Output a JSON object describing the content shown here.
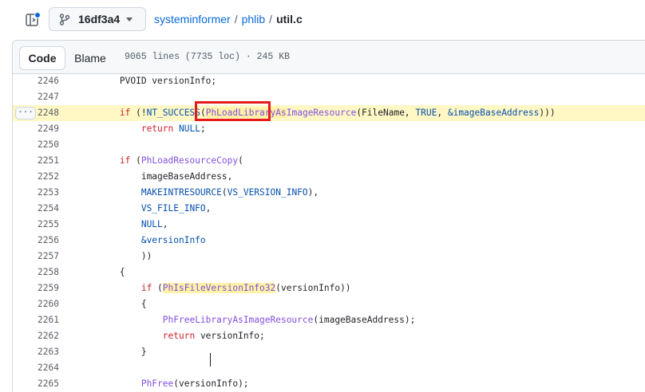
{
  "header": {
    "branch": "16df3a4",
    "breadcrumb": {
      "repo": "systeminformer",
      "folder": "phlib",
      "file": "util.c"
    }
  },
  "file_toolbar": {
    "tabs": [
      {
        "label": "Code",
        "selected": true
      },
      {
        "label": "Blame",
        "selected": false
      }
    ],
    "meta": "9065 lines (7735 loc) · 245 KB"
  },
  "code": {
    "highlighted_line": "2248",
    "lines": [
      {
        "num": "2246",
        "indent": "        ",
        "segments": [
          {
            "t": "PVOID versionInfo;"
          }
        ]
      },
      {
        "num": "2247",
        "indent": "",
        "segments": []
      },
      {
        "num": "2248",
        "indent": "        ",
        "segments": [
          {
            "t": "if",
            "c": "kw"
          },
          {
            "t": " (!"
          },
          {
            "t": "NT_SUCCESS",
            "c": "mc"
          },
          {
            "t": "("
          },
          {
            "t": "PhLoadLibraryAs",
            "c": "fn sym"
          },
          {
            "t": "ImageResource",
            "c": "fn"
          },
          {
            "t": "(FileName, "
          },
          {
            "t": "TRUE",
            "c": "mc"
          },
          {
            "t": ", "
          },
          {
            "t": "&imageBaseAddress",
            "c": "mc"
          },
          {
            "t": ")))"
          }
        ]
      },
      {
        "num": "2249",
        "indent": "            ",
        "segments": [
          {
            "t": "return",
            "c": "kw"
          },
          {
            "t": " "
          },
          {
            "t": "NULL",
            "c": "mc"
          },
          {
            "t": ";"
          }
        ]
      },
      {
        "num": "2250",
        "indent": "",
        "segments": []
      },
      {
        "num": "2251",
        "indent": "        ",
        "segments": [
          {
            "t": "if",
            "c": "kw"
          },
          {
            "t": " ("
          },
          {
            "t": "PhLoadResourceCopy",
            "c": "fn"
          },
          {
            "t": "("
          }
        ]
      },
      {
        "num": "2252",
        "indent": "            ",
        "segments": [
          {
            "t": "imageBaseAddress,"
          }
        ]
      },
      {
        "num": "2253",
        "indent": "            ",
        "segments": [
          {
            "t": "MAKEINTRESOURCE",
            "c": "mc"
          },
          {
            "t": "("
          },
          {
            "t": "VS_VERSION_INFO",
            "c": "mc"
          },
          {
            "t": "),"
          }
        ]
      },
      {
        "num": "2254",
        "indent": "            ",
        "segments": [
          {
            "t": "VS_FILE_INFO",
            "c": "mc"
          },
          {
            "t": ","
          }
        ]
      },
      {
        "num": "2255",
        "indent": "            ",
        "segments": [
          {
            "t": "NULL",
            "c": "mc"
          },
          {
            "t": ","
          }
        ]
      },
      {
        "num": "2256",
        "indent": "            ",
        "segments": [
          {
            "t": "&versionInfo",
            "c": "mc"
          }
        ]
      },
      {
        "num": "2257",
        "indent": "            ",
        "segments": [
          {
            "t": "))"
          }
        ]
      },
      {
        "num": "2258",
        "indent": "        ",
        "segments": [
          {
            "t": "{"
          }
        ]
      },
      {
        "num": "2259",
        "indent": "            ",
        "segments": [
          {
            "t": "if",
            "c": "kw"
          },
          {
            "t": " ("
          },
          {
            "t": "PhIsFileVersionInfo32",
            "c": "fn sym"
          },
          {
            "t": "(versionInfo))"
          }
        ]
      },
      {
        "num": "2260",
        "indent": "            ",
        "segments": [
          {
            "t": "{"
          }
        ]
      },
      {
        "num": "2261",
        "indent": "                ",
        "segments": [
          {
            "t": "PhFreeLibraryAsImageResource",
            "c": "fn"
          },
          {
            "t": "(imageBaseAddress);"
          }
        ]
      },
      {
        "num": "2262",
        "indent": "                ",
        "segments": [
          {
            "t": "return",
            "c": "kw"
          },
          {
            "t": " versionInfo;"
          }
        ]
      },
      {
        "num": "2263",
        "indent": "            ",
        "segments": [
          {
            "t": "}"
          }
        ]
      },
      {
        "num": "2264",
        "indent": "",
        "segments": []
      },
      {
        "num": "2265",
        "indent": "            ",
        "segments": [
          {
            "t": "PhFree",
            "c": "fn"
          },
          {
            "t": "(versionInfo);"
          }
        ]
      }
    ]
  },
  "colors": {
    "keyword": "#cf222e",
    "function": "#8250df",
    "constant": "#0550ae",
    "highlight": "#fff8c5",
    "annotation_box": "#e51b1b"
  },
  "icons": {
    "sidebar": "sidebar-collapse-icon",
    "branch": "git-branch-icon",
    "more": "kebab-horizontal-icon"
  }
}
